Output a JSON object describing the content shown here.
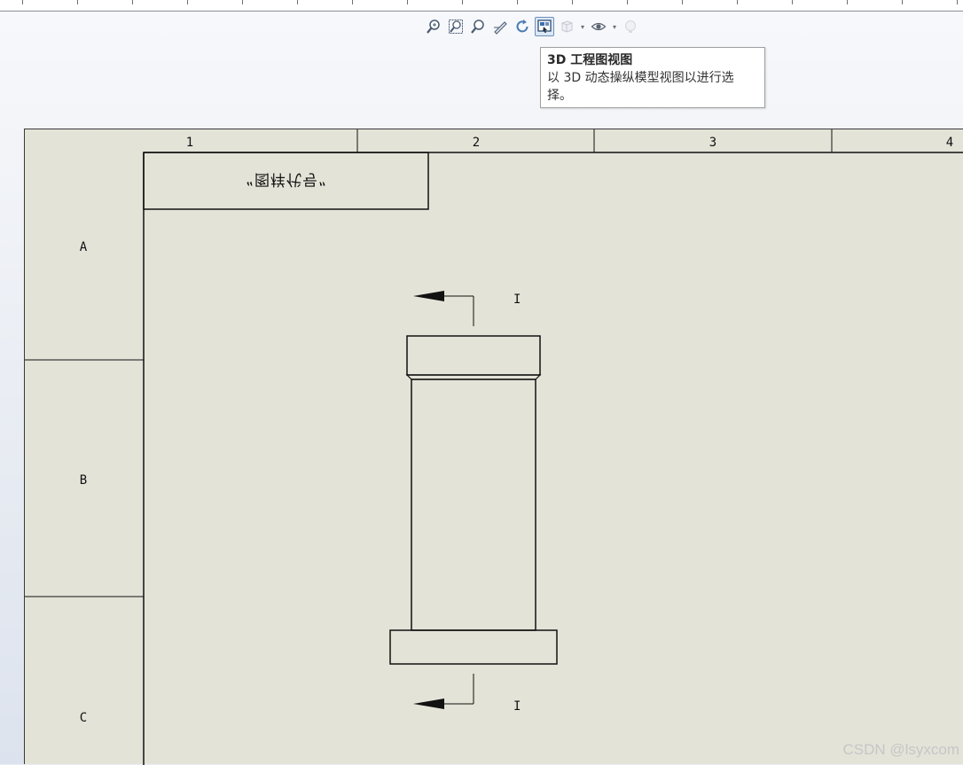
{
  "toolbar": {
    "items": [
      {
        "name": "zoom-to-fit",
        "icon": "zoom-fit-icon"
      },
      {
        "name": "zoom-to-area",
        "icon": "zoom-area-icon"
      },
      {
        "name": "zoom-in-out",
        "icon": "zoom-in-out-icon"
      },
      {
        "name": "pan",
        "icon": "pan-icon"
      },
      {
        "name": "rotate",
        "icon": "rotate-icon"
      },
      {
        "name": "3d-drawing-view",
        "icon": "3d-drawing-view-icon",
        "active": true
      },
      {
        "name": "view-orientation",
        "icon": "cube-icon",
        "disabled": true
      },
      {
        "name": "hide-show-items",
        "icon": "eye-icon"
      },
      {
        "name": "apply-scene",
        "icon": "bulb-icon",
        "disabled": true
      }
    ]
  },
  "tooltip": {
    "title": "3D 工程图视图",
    "line1": "以 3D 动态操纵模型视图以进行选",
    "line2": "择。"
  },
  "sheet": {
    "column_labels": [
      "1",
      "2",
      "3",
      "4"
    ],
    "row_labels": [
      "A",
      "B",
      "C"
    ],
    "title_box_text": "“图样代号”",
    "section_label_top": "I",
    "section_label_bottom": "I"
  },
  "watermark": "CSDN @lsyxcom",
  "colors": {
    "sheet_bg": "#e4e3d8",
    "line": "#111111",
    "tooltip_border": "#a0a0a0",
    "active_button": "#dbe8f7"
  }
}
